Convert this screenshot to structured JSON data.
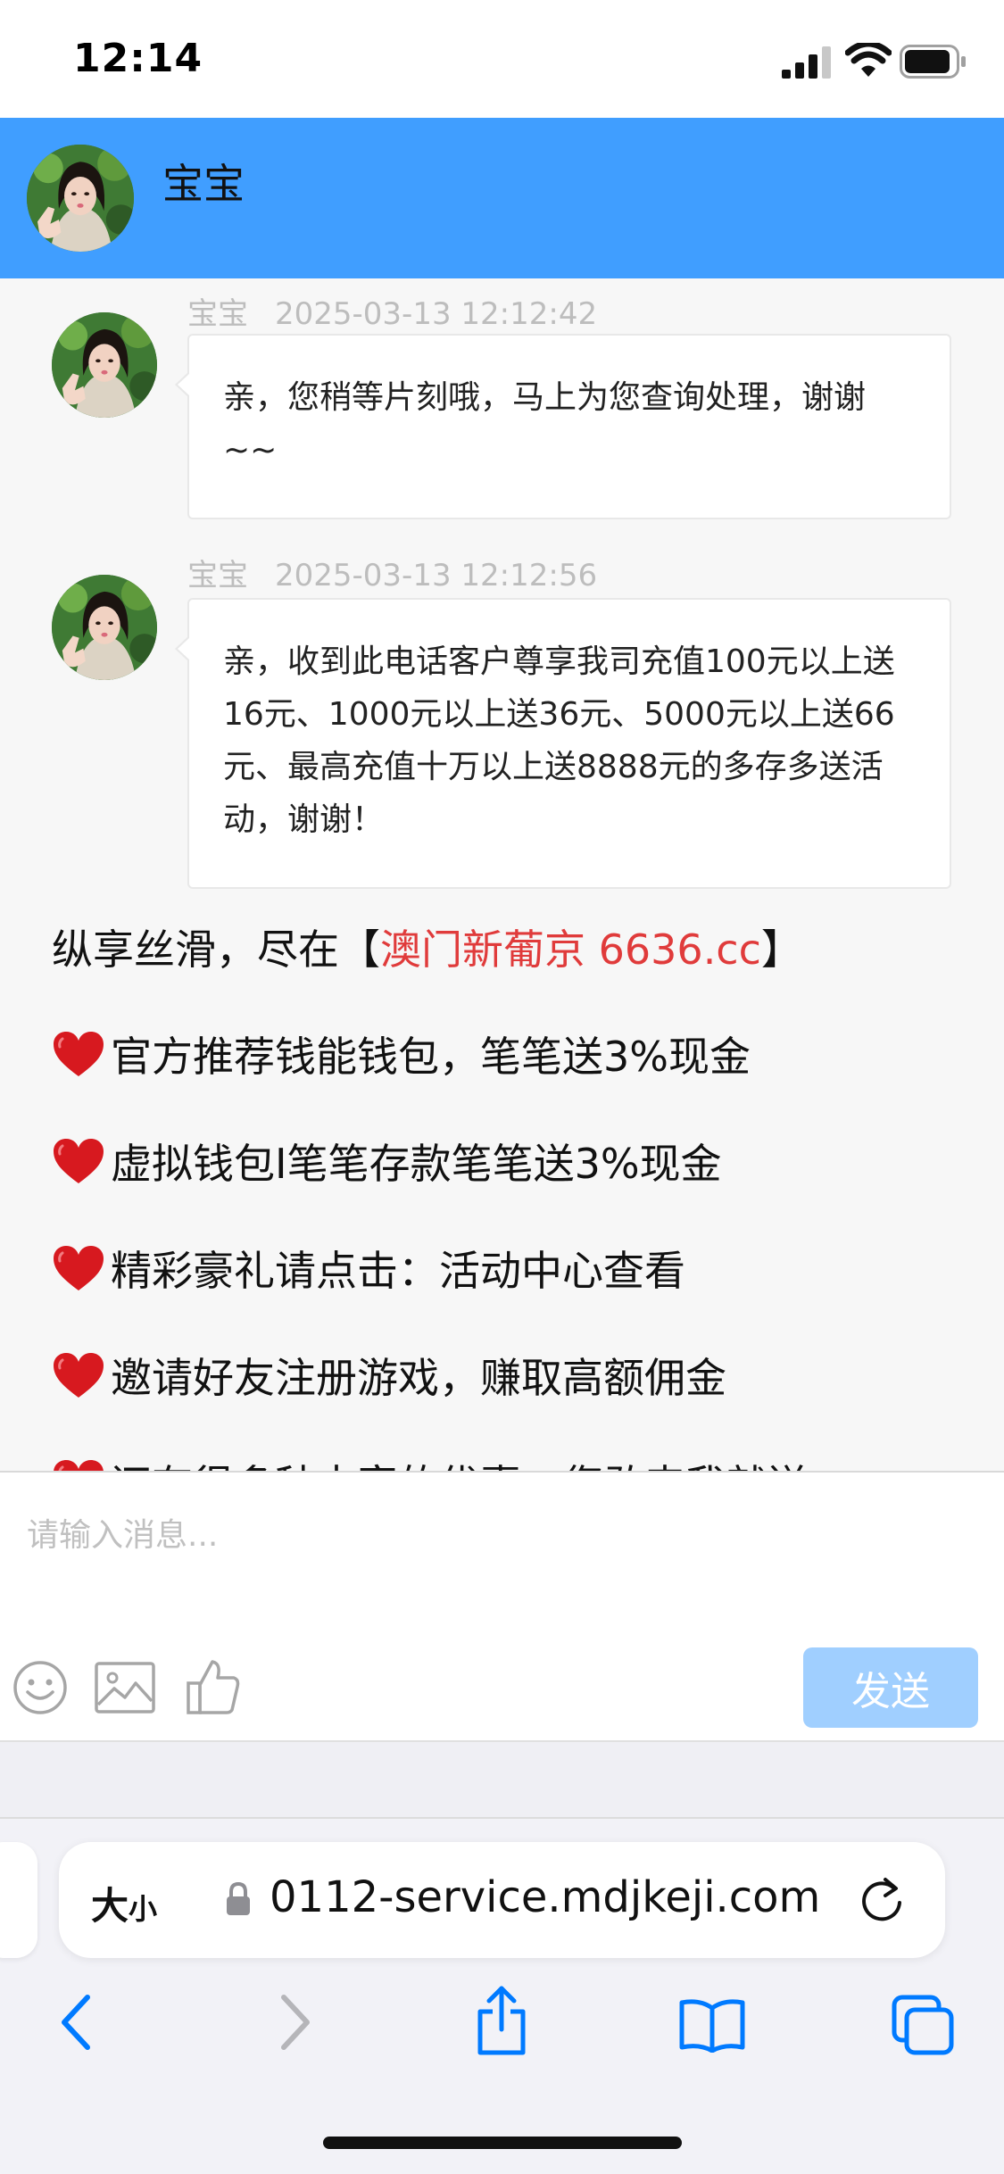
{
  "status_bar": {
    "time": "12:14"
  },
  "header": {
    "name": "宝宝"
  },
  "messages": [
    {
      "sender": "宝宝",
      "timestamp": "2025-03-13 12:12:42",
      "text": "亲，您稍等片刻哦，马上为您查询处理，谢谢~~"
    },
    {
      "sender": "宝宝",
      "timestamp": "2025-03-13 12:12:56",
      "text": "亲，收到此电话客户尊享我司充值100元以上送16元、1000元以上送36元、5000元以上送66元、最高充值十万以上送8888元的多存多送活动，谢谢！"
    }
  ],
  "promo": {
    "line1_prefix": "纵享丝滑，尽在【",
    "line1_highlight": "澳门新葡京 6636.cc",
    "line1_suffix": "】",
    "items": [
      "官方推荐钱能钱包，笔笔送3%现金",
      "虚拟钱包I笔笔存款笔笔送3%现金",
      "精彩豪礼请点击：活动中心查看",
      "邀请好友注册游戏，赚取高额佣金",
      "还有很多种丰富的优惠，您敢来我就送"
    ]
  },
  "input": {
    "placeholder": "请输入消息...",
    "send_label": "发送"
  },
  "browser": {
    "text_size_big": "大",
    "text_size_small": "小",
    "url": "0112-service.mdjkeji.com"
  },
  "colors": {
    "header": "#409eff",
    "send_button": "#a0cfff",
    "promo_red": "#e03b3b",
    "heart": "#d7191f"
  },
  "icons": [
    "signal-icon",
    "wifi-icon",
    "battery-icon",
    "heart-icon",
    "emoji-icon",
    "image-icon",
    "thumbs-up-icon",
    "lock-icon",
    "reload-icon",
    "back-icon",
    "forward-icon",
    "share-icon",
    "bookmarks-icon",
    "tabs-icon"
  ]
}
